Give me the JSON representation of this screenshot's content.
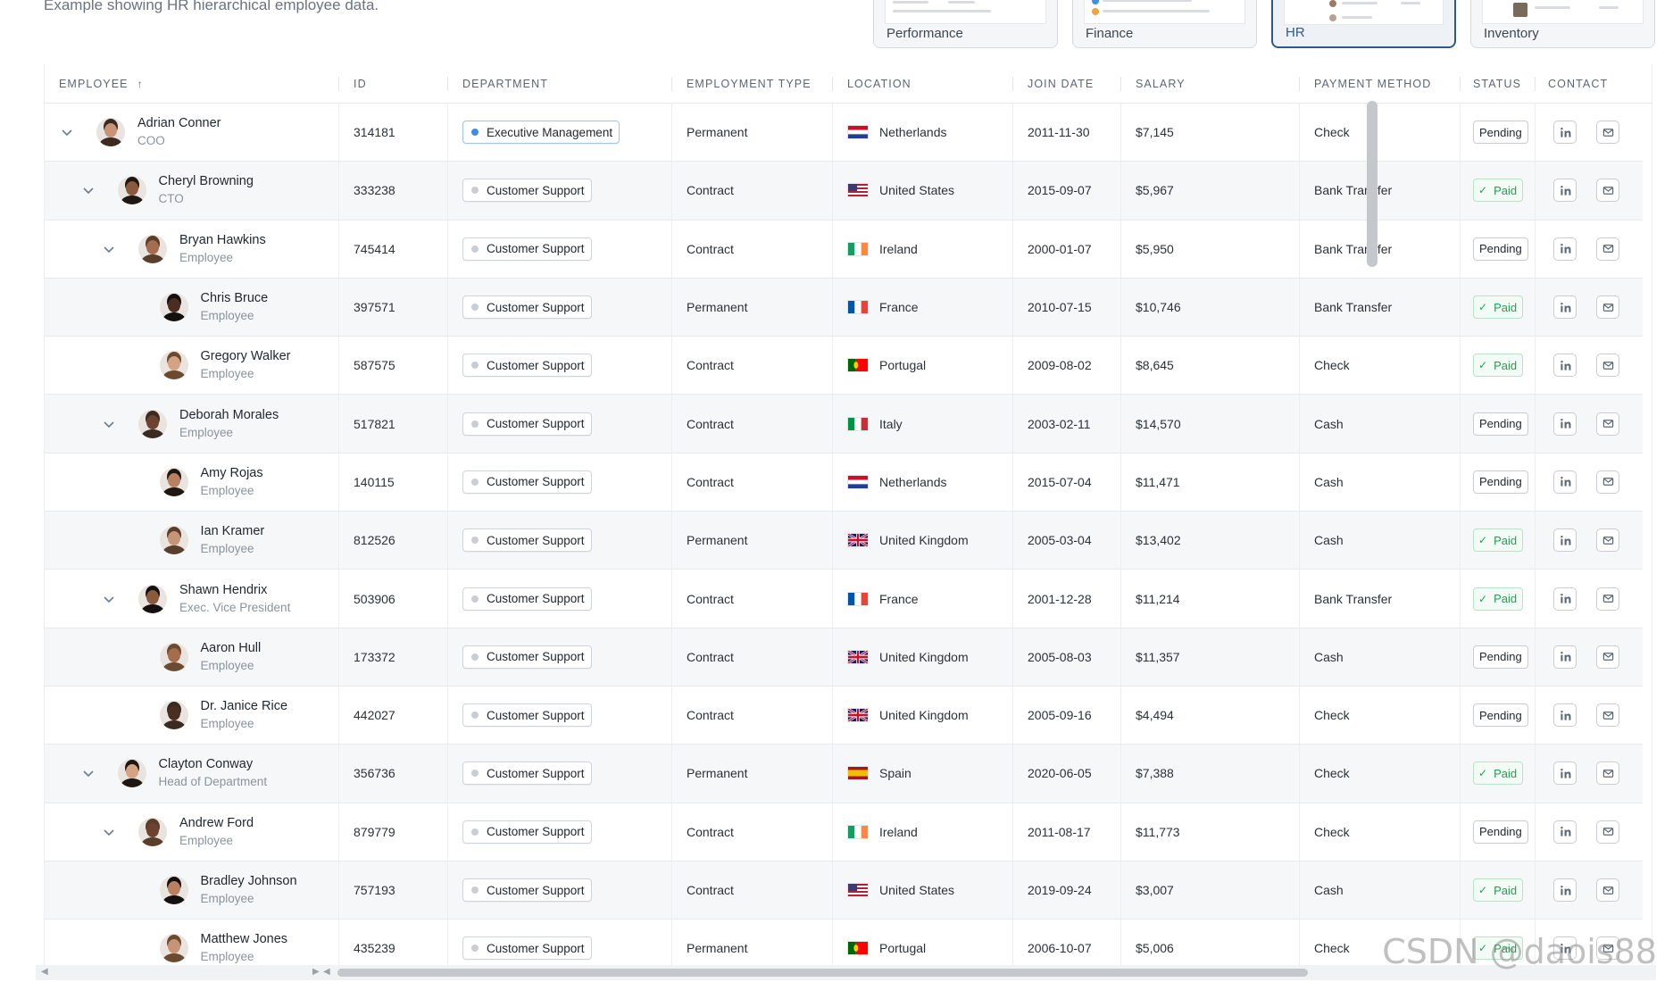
{
  "subtitle": "Example showing HR hierarchical employee data.",
  "demo_tabs": [
    {
      "label": "Performance",
      "active": false
    },
    {
      "label": "Finance",
      "active": false
    },
    {
      "label": "HR",
      "active": true
    },
    {
      "label": "Inventory",
      "active": false
    }
  ],
  "columns": [
    "Employee",
    "ID",
    "Department",
    "Employment Type",
    "Location",
    "Join Date",
    "Salary",
    "Payment Method",
    "Status",
    "Contact"
  ],
  "rows": [
    {
      "name": "Adrian Conner",
      "title": "COO",
      "id": "314181",
      "dept": "Executive Management",
      "type": "Permanent",
      "loc": "Netherlands",
      "flag": "nl",
      "join": "2011-11-30",
      "salary": "$7,145",
      "pay": "Check",
      "status": "Pending",
      "level": 0,
      "expander": true
    },
    {
      "name": "Cheryl Browning",
      "title": "CTO",
      "id": "333238",
      "dept": "Customer Support",
      "type": "Contract",
      "loc": "United States",
      "flag": "us",
      "join": "2015-09-07",
      "salary": "$5,967",
      "pay": "Bank Transfer",
      "status": "Paid",
      "level": 1,
      "expander": true
    },
    {
      "name": "Bryan Hawkins",
      "title": "Employee",
      "id": "745414",
      "dept": "Customer Support",
      "type": "Contract",
      "loc": "Ireland",
      "flag": "ie",
      "join": "2000-01-07",
      "salary": "$5,950",
      "pay": "Bank Transfer",
      "status": "Pending",
      "level": 2,
      "expander": true
    },
    {
      "name": "Chris Bruce",
      "title": "Employee",
      "id": "397571",
      "dept": "Customer Support",
      "type": "Permanent",
      "loc": "France",
      "flag": "fr",
      "join": "2010-07-15",
      "salary": "$10,746",
      "pay": "Bank Transfer",
      "status": "Paid",
      "level": 3,
      "expander": false
    },
    {
      "name": "Gregory Walker",
      "title": "Employee",
      "id": "587575",
      "dept": "Customer Support",
      "type": "Contract",
      "loc": "Portugal",
      "flag": "pt",
      "join": "2009-08-02",
      "salary": "$8,645",
      "pay": "Check",
      "status": "Paid",
      "level": 3,
      "expander": false
    },
    {
      "name": "Deborah Morales",
      "title": "Employee",
      "id": "517821",
      "dept": "Customer Support",
      "type": "Contract",
      "loc": "Italy",
      "flag": "it",
      "join": "2003-02-11",
      "salary": "$14,570",
      "pay": "Cash",
      "status": "Pending",
      "level": 2,
      "expander": true
    },
    {
      "name": "Amy Rojas",
      "title": "Employee",
      "id": "140115",
      "dept": "Customer Support",
      "type": "Contract",
      "loc": "Netherlands",
      "flag": "nl",
      "join": "2015-07-04",
      "salary": "$11,471",
      "pay": "Cash",
      "status": "Pending",
      "level": 3,
      "expander": false
    },
    {
      "name": "Ian Kramer",
      "title": "Employee",
      "id": "812526",
      "dept": "Customer Support",
      "type": "Permanent",
      "loc": "United Kingdom",
      "flag": "gb",
      "join": "2005-03-04",
      "salary": "$13,402",
      "pay": "Cash",
      "status": "Paid",
      "level": 3,
      "expander": false
    },
    {
      "name": "Shawn Hendrix",
      "title": "Exec. Vice President",
      "id": "503906",
      "dept": "Customer Support",
      "type": "Contract",
      "loc": "France",
      "flag": "fr",
      "join": "2001-12-28",
      "salary": "$11,214",
      "pay": "Bank Transfer",
      "status": "Paid",
      "level": 2,
      "expander": true
    },
    {
      "name": "Aaron Hull",
      "title": "Employee",
      "id": "173372",
      "dept": "Customer Support",
      "type": "Contract",
      "loc": "United Kingdom",
      "flag": "gb",
      "join": "2005-08-03",
      "salary": "$11,357",
      "pay": "Cash",
      "status": "Pending",
      "level": 3,
      "expander": false
    },
    {
      "name": "Dr. Janice Rice",
      "title": "Employee",
      "id": "442027",
      "dept": "Customer Support",
      "type": "Contract",
      "loc": "United Kingdom",
      "flag": "gb",
      "join": "2005-09-16",
      "salary": "$4,494",
      "pay": "Check",
      "status": "Pending",
      "level": 3,
      "expander": false
    },
    {
      "name": "Clayton Conway",
      "title": "Head of Department",
      "id": "356736",
      "dept": "Customer Support",
      "type": "Permanent",
      "loc": "Spain",
      "flag": "es",
      "join": "2020-06-05",
      "salary": "$7,388",
      "pay": "Check",
      "status": "Paid",
      "level": 1,
      "expander": true
    },
    {
      "name": "Andrew Ford",
      "title": "Employee",
      "id": "879779",
      "dept": "Customer Support",
      "type": "Contract",
      "loc": "Ireland",
      "flag": "ie",
      "join": "2011-08-17",
      "salary": "$11,773",
      "pay": "Check",
      "status": "Pending",
      "level": 2,
      "expander": true
    },
    {
      "name": "Bradley Johnson",
      "title": "Employee",
      "id": "757193",
      "dept": "Customer Support",
      "type": "Contract",
      "loc": "United States",
      "flag": "us",
      "join": "2019-09-24",
      "salary": "$3,007",
      "pay": "Cash",
      "status": "Paid",
      "level": 3,
      "expander": false
    },
    {
      "name": "Matthew Jones",
      "title": "Employee",
      "id": "435239",
      "dept": "Customer Support",
      "type": "Permanent",
      "loc": "Portugal",
      "flag": "pt",
      "join": "2006-10-07",
      "salary": "$5,006",
      "pay": "Check",
      "status": "Paid",
      "level": 3,
      "expander": false
    }
  ],
  "watermark": "CSDN @daois88"
}
